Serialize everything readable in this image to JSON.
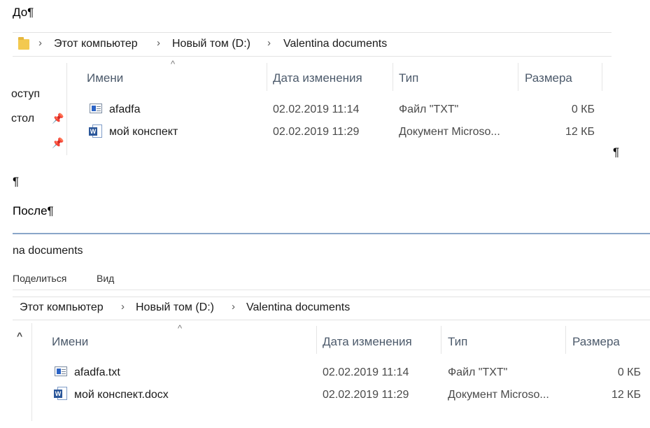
{
  "doc": {
    "before_label": "До¶",
    "after_label": "После¶",
    "pilcrow_right": "¶",
    "pilcrow_empty": "¶"
  },
  "before": {
    "breadcrumb": {
      "chevron": "›",
      "items": [
        "Этот компьютер",
        "Новый том (D:)",
        "Valentina documents"
      ]
    },
    "sort_arrow": "^",
    "columns": {
      "name": "Имени",
      "date": "Дата изменения",
      "type": "Тип",
      "size": "Размера"
    },
    "sidebar": {
      "item1": "оступ",
      "item2": "стол"
    },
    "files": [
      {
        "name": "afadfa",
        "date": "02.02.2019 11:14",
        "type": "Файл \"TXT\"",
        "size": "0 КБ",
        "icon": "txt-file-icon"
      },
      {
        "name": "мой конспект",
        "date": "02.02.2019 11:29",
        "type": "Документ Microso...",
        "size": "12 КБ",
        "icon": "word-file-icon"
      }
    ]
  },
  "after": {
    "title": "na documents",
    "ribbon": {
      "share": "Поделиться",
      "view": "Вид"
    },
    "breadcrumb": {
      "chevron": "›",
      "items": [
        "Этот компьютер",
        "Новый том (D:)",
        "Valentina documents"
      ]
    },
    "sort_arrow": "^",
    "collapse_arrow": "^",
    "columns": {
      "name": "Имени",
      "date": "Дата изменения",
      "type": "Тип",
      "size": "Размера"
    },
    "files": [
      {
        "name": "afadfa.txt",
        "date": "02.02.2019 11:14",
        "type": "Файл \"TXT\"",
        "size": "0 КБ",
        "icon": "txt-file-icon"
      },
      {
        "name": "мой конспект.docx",
        "date": "02.02.2019 11:29",
        "type": "Документ Microso...",
        "size": "12 КБ",
        "icon": "word-file-icon"
      }
    ]
  },
  "colors": {
    "window_border": "#8aa6c9",
    "header_text": "#4c5a6b",
    "word_blue": "#2b579a",
    "folder_yellow": "#f3c94f"
  }
}
